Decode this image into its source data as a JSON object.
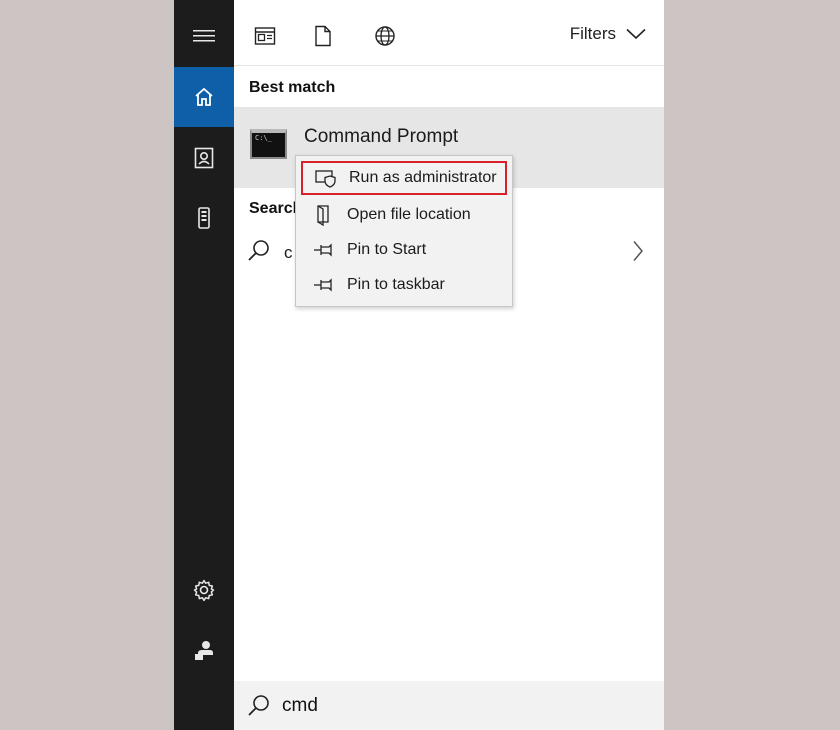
{
  "rail": {
    "items": [
      {
        "name": "hamburger-menu"
      },
      {
        "name": "home",
        "active": true
      },
      {
        "name": "documents"
      },
      {
        "name": "device"
      },
      {
        "name": "settings"
      },
      {
        "name": "user-account"
      }
    ]
  },
  "tabs": [
    "apps-tab",
    "documents-tab",
    "web-tab"
  ],
  "filters": {
    "label": "Filters"
  },
  "best_match": {
    "heading": "Best match",
    "item": {
      "name": "Command Prompt",
      "icon_text": "C:\\_"
    }
  },
  "search_web": {
    "heading": "Search",
    "query_partial": "c"
  },
  "context_menu": {
    "items": [
      {
        "label": "Run as administrator",
        "icon": "shield-icon",
        "highlighted": true
      },
      {
        "label": "Open file location",
        "icon": "folder-icon"
      },
      {
        "label": "Pin to Start",
        "icon": "pin-icon"
      },
      {
        "label": "Pin to taskbar",
        "icon": "pin-icon"
      }
    ]
  },
  "search": {
    "value": "cmd"
  },
  "colors": {
    "rail_bg": "#1c1c1c",
    "active_accent": "#0f5fa8",
    "highlight_border": "#d8202a",
    "selected_item_bg": "#e6e6e6"
  }
}
